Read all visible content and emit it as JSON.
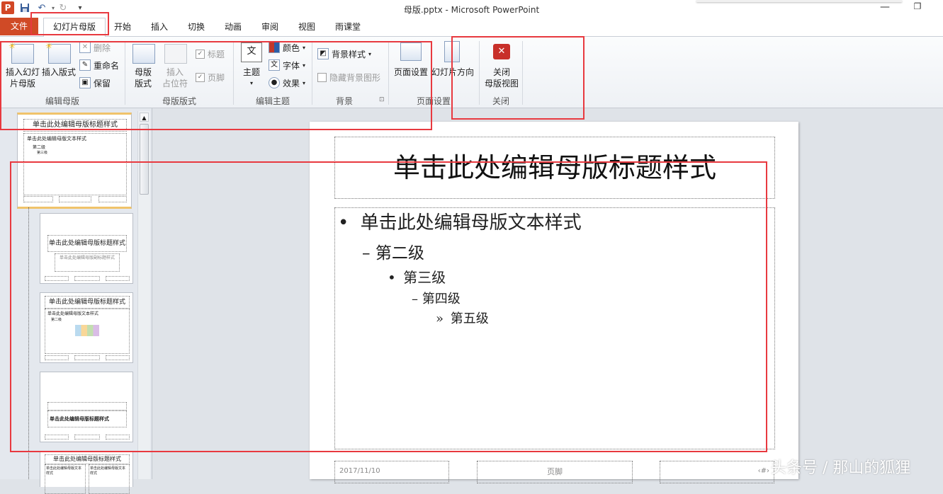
{
  "window": {
    "title": "母版.pptx - Microsoft PowerPoint",
    "app_icon": "P",
    "qat": [
      "save-icon",
      "undo-icon",
      "redo-icon",
      "customize-qat-icon"
    ]
  },
  "tabs": {
    "file": "文件",
    "active": "幻灯片母版",
    "others": [
      "开始",
      "插入",
      "切换",
      "动画",
      "审阅",
      "视图",
      "雨课堂"
    ]
  },
  "ribbon": {
    "edit_master": {
      "insert_slide_master": [
        "插入幻灯",
        "片母版"
      ],
      "insert_layout": "插入版式",
      "delete": "删除",
      "rename": "重命名",
      "preserve": "保留",
      "label": "编辑母版"
    },
    "master_layout": {
      "master_layout_btn": [
        "母版",
        "版式"
      ],
      "insert_placeholder": [
        "插入",
        "占位符"
      ],
      "title_chk": "标题",
      "footer_chk": "页脚",
      "label": "母版版式"
    },
    "edit_theme": {
      "themes": "主题",
      "colors": "颜色",
      "fonts": "字体",
      "effects": "效果",
      "label": "编辑主题"
    },
    "background": {
      "bg_styles": "背景样式",
      "hide_bg": "隐藏背景图形",
      "label": "背景"
    },
    "page_setup": {
      "page_setup": "页面设置",
      "orientation": "幻灯片方向",
      "label": "页面设置"
    },
    "close": {
      "close_master": [
        "关闭",
        "母版视图"
      ],
      "label": "关闭"
    }
  },
  "thumbnails": {
    "master_title": "单击此处编辑母版标题样式",
    "master_text": "单击此处编辑母版文本样式",
    "master_l2": "第二级",
    "master_l3": "第三级",
    "layout_title": "单击此处编辑母版标题样式",
    "layout_subtitle": "单击此处编辑母版副标题样式",
    "section_title": "单击此处编辑母版标题样式",
    "two_col_left": "单击此处编辑母版文本样式",
    "two_col_right": "单击此处编辑母版文本样式"
  },
  "slide": {
    "title": "单击此处编辑母版标题样式",
    "bullets": [
      {
        "marker": "•",
        "text": "单击此处编辑母版文本样式"
      },
      {
        "marker": "–",
        "text": "第二级"
      },
      {
        "marker": "•",
        "text": "第三级"
      },
      {
        "marker": "–",
        "text": "第四级"
      },
      {
        "marker": "»",
        "text": "第五级"
      }
    ],
    "date": "2017/11/10",
    "footer": "页脚",
    "page_num": "‹#›"
  },
  "watermark": "头条号 / 那山的狐狸",
  "colors": {
    "file_tab": "#d04a26",
    "highlight_box": "#e8393f",
    "close_icon": "#c8302a"
  }
}
